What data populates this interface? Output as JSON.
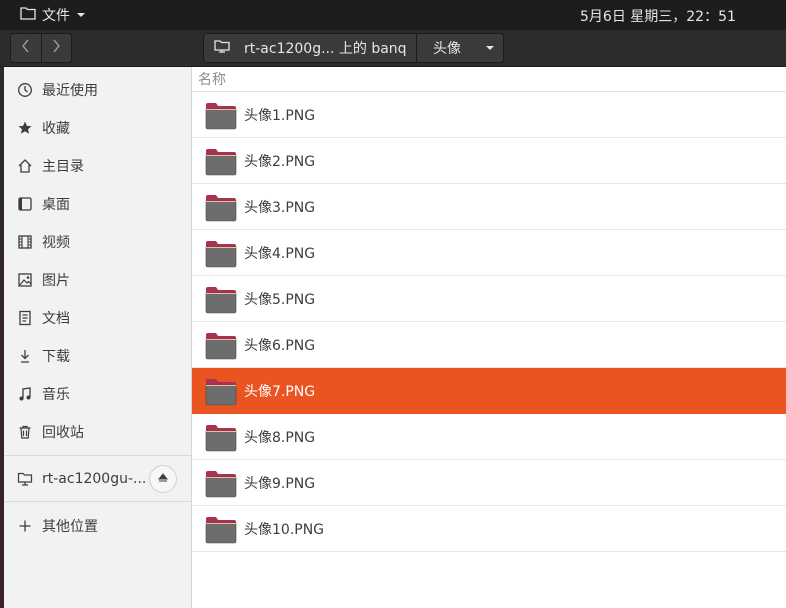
{
  "topbar": {
    "app_menu_label": "文件",
    "clock": "5月6日 星期三，22：51"
  },
  "header": {
    "path": [
      "rt-ac1200g... 上的 banq",
      "头像"
    ]
  },
  "sidebar": {
    "items": [
      {
        "label": "最近使用",
        "icon": "clock-icon"
      },
      {
        "label": "收藏",
        "icon": "star-icon"
      },
      {
        "label": "主目录",
        "icon": "home-icon"
      },
      {
        "label": "桌面",
        "icon": "desktop-icon"
      },
      {
        "label": "视频",
        "icon": "video-icon"
      },
      {
        "label": "图片",
        "icon": "image-icon"
      },
      {
        "label": "文档",
        "icon": "document-icon"
      },
      {
        "label": "下载",
        "icon": "download-icon"
      },
      {
        "label": "音乐",
        "icon": "music-icon"
      },
      {
        "label": "回收站",
        "icon": "trash-icon"
      }
    ],
    "network_drive": {
      "label": "rt-ac1200gu-...",
      "icon": "network-drive-icon"
    },
    "other_locations": {
      "label": "其他位置",
      "icon": "plus-icon"
    }
  },
  "main": {
    "column_header": "名称",
    "files": [
      {
        "name": "头像1.PNG"
      },
      {
        "name": "头像2.PNG"
      },
      {
        "name": "头像3.PNG"
      },
      {
        "name": "头像4.PNG"
      },
      {
        "name": "头像5.PNG"
      },
      {
        "name": "头像6.PNG"
      },
      {
        "name": "头像7.PNG"
      },
      {
        "name": "头像8.PNG"
      },
      {
        "name": "头像9.PNG"
      },
      {
        "name": "头像10.PNG"
      }
    ],
    "selected_file": "头像7.PNG"
  },
  "colors": {
    "accent": "#e95420",
    "topbar": "#1d1d1d",
    "headerbar": "#2c2c2c",
    "folder_body": "#6d6d6d",
    "folder_tab": "#a8324f"
  }
}
